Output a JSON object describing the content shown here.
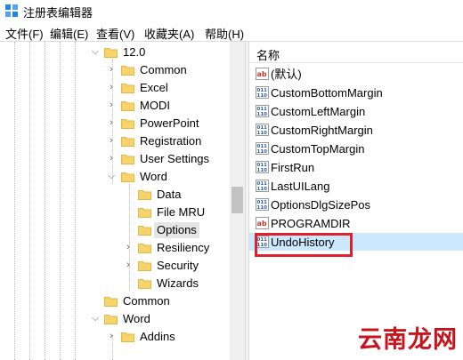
{
  "window": {
    "title": "注册表编辑器"
  },
  "menu": [
    "文件(F)",
    "编辑(E)",
    "查看(V)",
    "收藏夹(A)",
    "帮助(H)"
  ],
  "tree": {
    "nodes": [
      {
        "label": "12.0",
        "expanded": true
      },
      {
        "label": "Common",
        "expanded": false
      },
      {
        "label": "Excel",
        "expanded": false
      },
      {
        "label": "MODI",
        "expanded": false
      },
      {
        "label": "PowerPoint",
        "expanded": false
      },
      {
        "label": "Registration",
        "expanded": false
      },
      {
        "label": "User Settings",
        "expanded": false
      },
      {
        "label": "Word",
        "expanded": true
      },
      {
        "label": "Data"
      },
      {
        "label": "File MRU"
      },
      {
        "label": "Options",
        "selected": true
      },
      {
        "label": "Resiliency",
        "expanded": false
      },
      {
        "label": "Security",
        "expanded": false
      },
      {
        "label": "Wizards"
      },
      {
        "label": "Common"
      },
      {
        "label": "Word",
        "expanded": true
      },
      {
        "label": "Addins",
        "expanded": false
      }
    ]
  },
  "values_pane": {
    "column_header": "名称",
    "items": [
      {
        "name": "(默认)",
        "type": "string"
      },
      {
        "name": "CustomBottomMargin",
        "type": "binary"
      },
      {
        "name": "CustomLeftMargin",
        "type": "binary"
      },
      {
        "name": "CustomRightMargin",
        "type": "binary"
      },
      {
        "name": "CustomTopMargin",
        "type": "binary"
      },
      {
        "name": "FirstRun",
        "type": "binary"
      },
      {
        "name": "LastUILang",
        "type": "binary"
      },
      {
        "name": "OptionsDlgSizePos",
        "type": "binary"
      },
      {
        "name": "PROGRAMDIR",
        "type": "string"
      },
      {
        "name": "UndoHistory",
        "type": "binary",
        "selected": true
      }
    ]
  },
  "watermark": "云南龙网",
  "colors": {
    "folder": "#f7d36c",
    "folder_edge": "#e2b647",
    "selected_row": "#cce8ff",
    "highlight_box": "#e0202a",
    "watermark": "#c8141c",
    "string_icon": "#c0392b",
    "binary_icon": "#2a5caa"
  }
}
